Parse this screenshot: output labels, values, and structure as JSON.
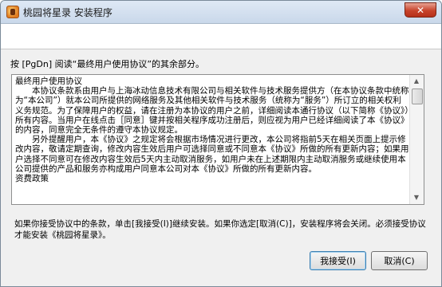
{
  "window": {
    "title": "桃园将星录 安装程序",
    "close_glyph": "✕"
  },
  "instruction": "按 [PgDn] 阅读“最终用户使用协议”的其余部分。",
  "license": {
    "text": "最终用户使用协议\n　　本协议条款系由用户与上海冰动信息技术有限公司与相关软件与技术服务提供方（在本协议条款中统称为“本公司”）就本公司所提供的网络服务及其他相关软件与技术服务（统称为“服务”）所订立的相关权利义务规范。为了保障用户的权益，请在注册为本协议的用户之前，详细阅读本通行协议（以下简称《协议》）所有内容。当用户在线点击［同意］键并按相关程序成功注册后，则应视为用户已经详细阅读了本《协议》的内容，同意完全无条件的遵守本协议规定。\n　　另外提醒用户，本《协议》之规定将会根据市场情况进行更改，本公司将指前5天在相关页面上提示修改内容，敬请定期查询，修改内容生效后用户可选择同意或不同意本《协议》所做的所有更新内容；如果用户选择不同意可在修改内容生效后5天内主动取消服务，如用户未在上述期限内主动取消服务或继续使用本公司提供的产品和服务亦构成用户同意本公司对本《协议》所做的所有更新内容。\n资费政策"
  },
  "footer": "如果你接受协议中的条款，单击[我接受(I)]继续安装。如果你选定[取消(C)]，安装程序将会关闭。必须接受协议才能安装《桃园将星录》。",
  "buttons": {
    "accept": "我接受(I)",
    "cancel": "取消(C)"
  },
  "icons": {
    "scroll_up": "▲",
    "scroll_down": "▼"
  }
}
